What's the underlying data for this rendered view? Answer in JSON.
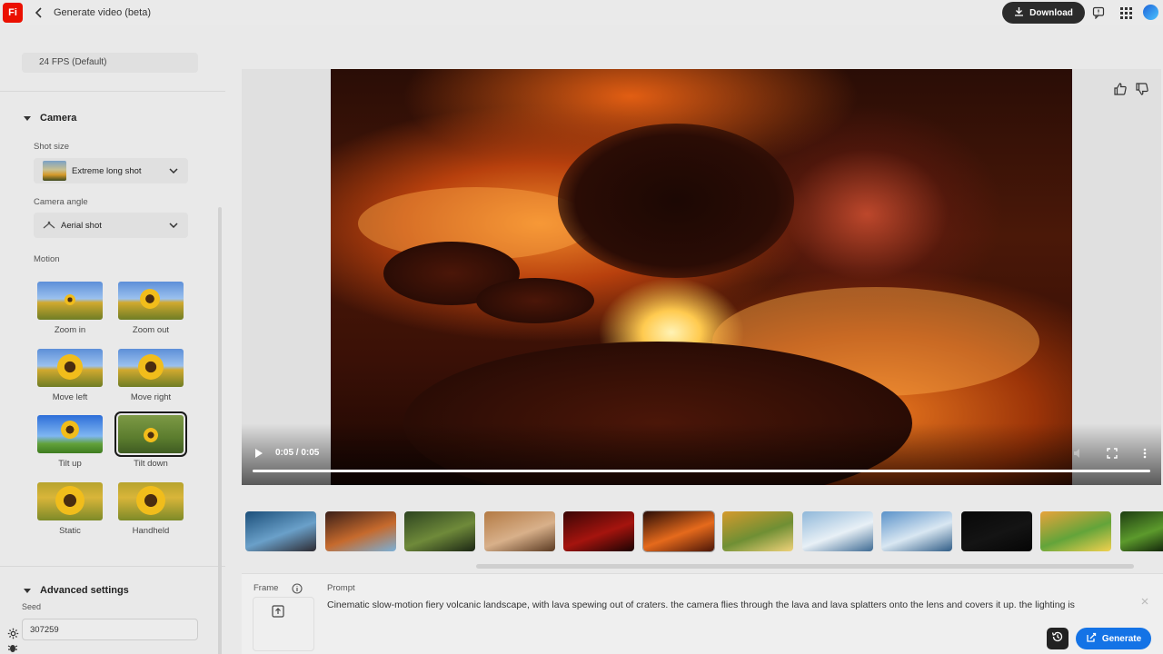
{
  "app": {
    "logo_text": "Fi",
    "title": "Generate video (beta)",
    "brand_color": "#eb1000",
    "accent_color": "#1473e6"
  },
  "header": {
    "download_label": "Download",
    "icons": [
      "back-chevron-icon",
      "download-icon",
      "feedback-icon",
      "apps-grid-icon",
      "avatar"
    ]
  },
  "sidebar": {
    "frame_rate_value": "24 FPS (Default)",
    "camera": {
      "section_title": "Camera",
      "shot_size_label": "Shot size",
      "shot_size_value": "Extreme long shot",
      "camera_angle_label": "Camera angle",
      "camera_angle_value": "Aerial shot"
    },
    "motion": {
      "label": "Motion",
      "items": [
        {
          "label": "Zoom in",
          "selected": false
        },
        {
          "label": "Zoom out",
          "selected": false
        },
        {
          "label": "Move left",
          "selected": false
        },
        {
          "label": "Move right",
          "selected": false
        },
        {
          "label": "Tilt up",
          "selected": false
        },
        {
          "label": "Tilt down",
          "selected": true
        },
        {
          "label": "Static",
          "selected": false
        },
        {
          "label": "Handheld",
          "selected": false
        }
      ]
    },
    "advanced": {
      "section_title": "Advanced settings",
      "seed_label": "Seed",
      "seed_value": "307259"
    }
  },
  "video": {
    "time": "0:05 / 0:05",
    "progress": 1.0,
    "controls": [
      "play-icon",
      "volume-icon",
      "fullscreen-icon",
      "more-vertical-icon"
    ],
    "feedback": [
      "thumbs-up-icon",
      "thumbs-down-icon"
    ]
  },
  "thumbnails": [
    {
      "name": "lake-scene",
      "colors": [
        "#1c4f7a",
        "#6aa0c9",
        "#2d2a30"
      ]
    },
    {
      "name": "portrait-sunset",
      "colors": [
        "#3a1f18",
        "#c66a2d",
        "#7ab0d8"
      ]
    },
    {
      "name": "forest-creature",
      "colors": [
        "#2d4420",
        "#6f8a3a",
        "#1b2614"
      ]
    },
    {
      "name": "dog-office",
      "colors": [
        "#b37a44",
        "#d8b08a",
        "#5a3a22"
      ]
    },
    {
      "name": "red-theater",
      "colors": [
        "#3a0606",
        "#a5140e",
        "#1a0303"
      ]
    },
    {
      "name": "volcano",
      "colors": [
        "#2a0d06",
        "#e56a1c",
        "#4b1608"
      ]
    },
    {
      "name": "river-valley",
      "colors": [
        "#d59a2c",
        "#6f8f34",
        "#f0d27a"
      ]
    },
    {
      "name": "snowy-mountains",
      "colors": [
        "#8fb7d9",
        "#e8f0f6",
        "#3d6a93"
      ]
    },
    {
      "name": "alpine-lake",
      "colors": [
        "#5a92c9",
        "#d9e7f2",
        "#2f5c86"
      ]
    },
    {
      "name": "dark-frame",
      "colors": [
        "#080808",
        "#141414",
        "#050505"
      ]
    },
    {
      "name": "cartoon-path",
      "colors": [
        "#e8a33b",
        "#63a43a",
        "#f2d14f"
      ]
    },
    {
      "name": "green-sprout",
      "colors": [
        "#1e3d12",
        "#5c9a2c",
        "#0f2009"
      ]
    }
  ],
  "prompt": {
    "frame_label": "Frame",
    "label": "Prompt",
    "text": "Cinematic slow-motion fiery volcanic landscape, with lava spewing out of craters. the camera flies through the lava and lava splatters onto the lens and covers it up. the lighting is",
    "generate_label": "Generate"
  }
}
